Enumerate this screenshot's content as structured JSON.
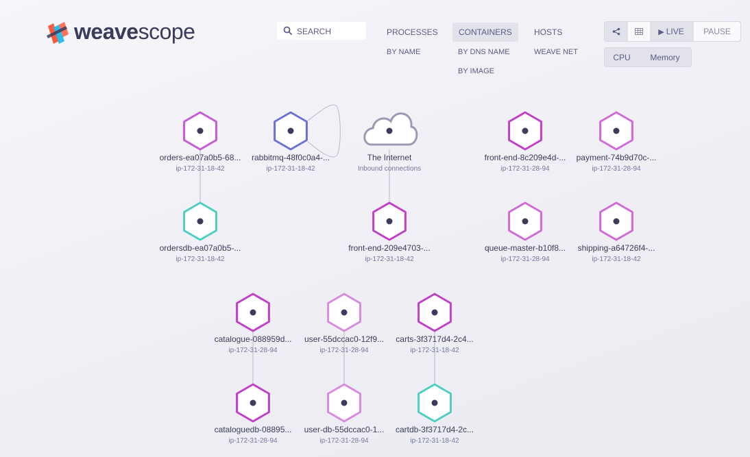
{
  "logo": {
    "part1": "weave",
    "part2": "scope"
  },
  "search": {
    "placeholder": "SEARCH"
  },
  "topologies": [
    {
      "label": "PROCESSES",
      "sub": [
        "BY NAME"
      ]
    },
    {
      "label": "CONTAINERS",
      "sub": [
        "BY DNS NAME",
        "BY IMAGE"
      ],
      "active": true
    },
    {
      "label": "HOSTS",
      "sub": [
        "WEAVE NET"
      ]
    }
  ],
  "view_controls": {
    "graph_icon": "share-icon",
    "table_icon": "grid-icon",
    "live": "LIVE",
    "pause": "PAUSE"
  },
  "metrics": {
    "cpu": "CPU",
    "memory": "Memory"
  },
  "nodes": [
    {
      "name": "orders-ea07a0b5-68...",
      "host": "ip-172-31-18-42",
      "color": "#c55bd6"
    },
    {
      "name": "rabbitmq-48f0c0a4-...",
      "host": "ip-172-31-18-42",
      "color": "#6b72d2"
    },
    {
      "name": "The Internet",
      "host": "Inbound connections",
      "color": "#9a9ab4"
    },
    {
      "name": "front-end-8c209e4d-...",
      "host": "ip-172-31-28-94",
      "color": "#c23fc9"
    },
    {
      "name": "payment-74b9d70c-...",
      "host": "ip-172-31-28-94",
      "color": "#cf6ad7"
    },
    {
      "name": "ordersdb-ea07a0b5-...",
      "host": "ip-172-31-18-42",
      "color": "#4ecec0"
    },
    {
      "name": "front-end-209e4703-...",
      "host": "ip-172-31-18-42",
      "color": "#c23fc9"
    },
    {
      "name": "queue-master-b10f8...",
      "host": "ip-172-31-28-94",
      "color": "#cf6ad7"
    },
    {
      "name": "shipping-a64726f4-...",
      "host": "ip-172-31-18-42",
      "color": "#cf6ad7"
    },
    {
      "name": "catalogue-088959d...",
      "host": "ip-172-31-28-94",
      "color": "#c23fc9"
    },
    {
      "name": "user-55dccac0-12f9...",
      "host": "ip-172-31-28-94",
      "color": "#d88adf"
    },
    {
      "name": "carts-3f3717d4-2c4...",
      "host": "ip-172-31-18-42",
      "color": "#c23fc9"
    },
    {
      "name": "cataloguedb-08895...",
      "host": "ip-172-31-28-94",
      "color": "#c23fc9"
    },
    {
      "name": "user-db-55dccac0-1...",
      "host": "ip-172-31-28-94",
      "color": "#d88adf"
    },
    {
      "name": "cartdb-3f3717d4-2c...",
      "host": "ip-172-31-18-42",
      "color": "#4ecec0"
    }
  ]
}
